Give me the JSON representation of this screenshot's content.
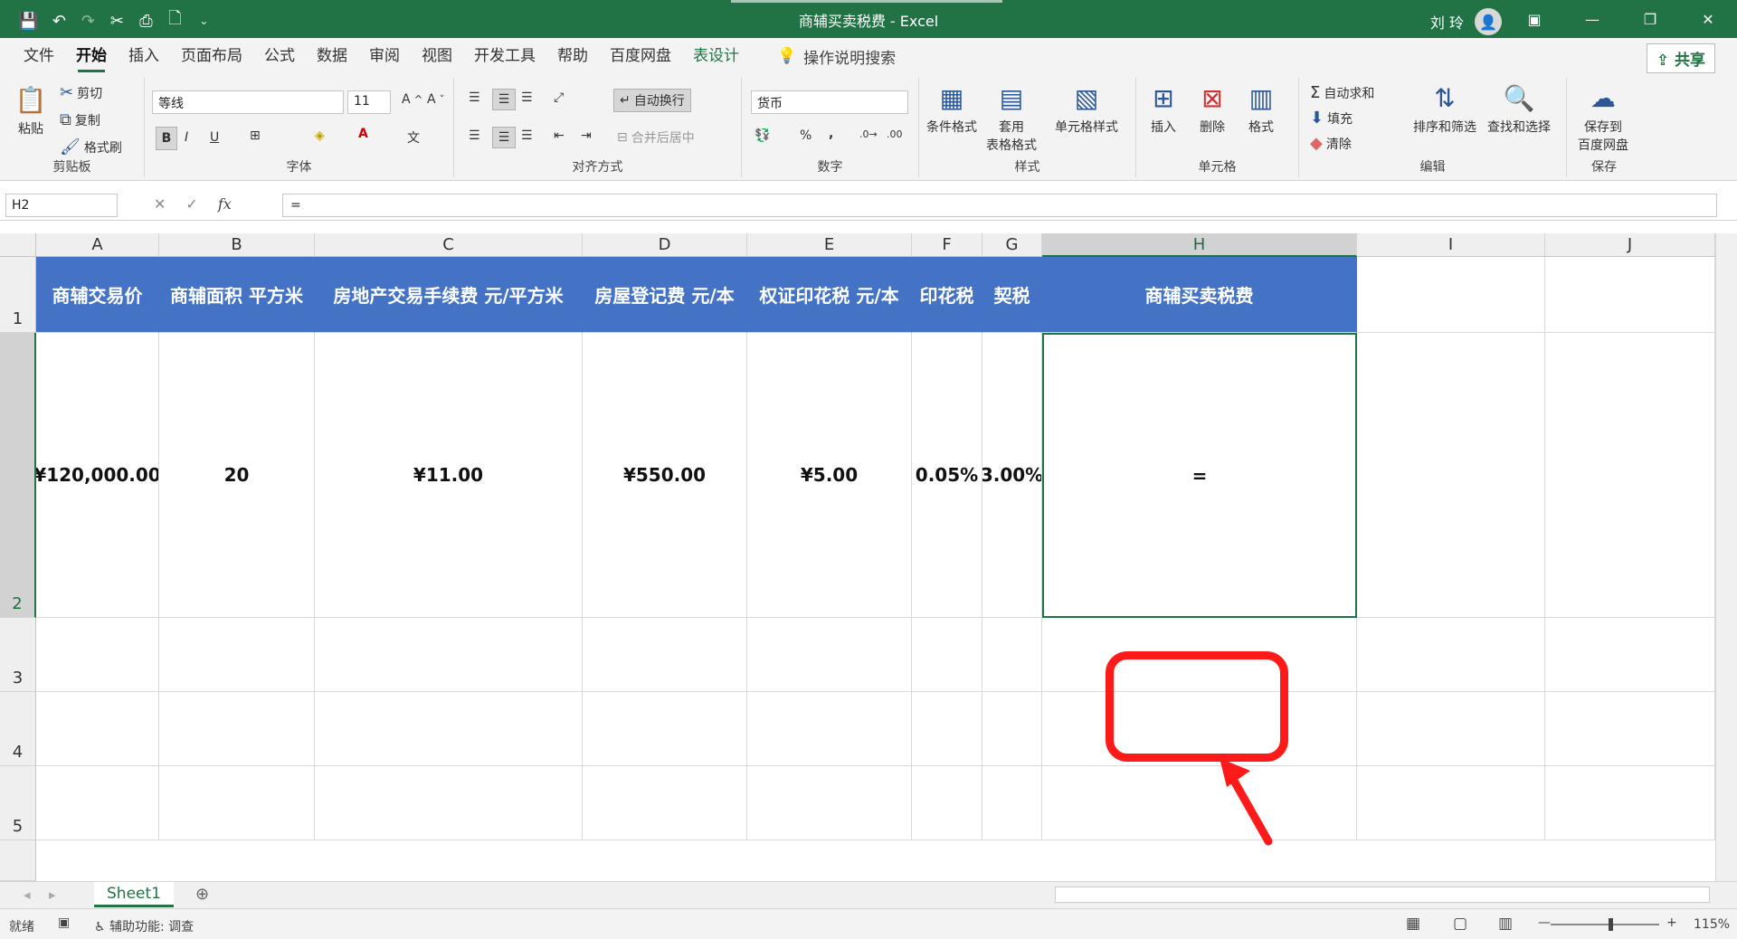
{
  "window": {
    "title": "商辅买卖税费  -  Excel",
    "user": "刘 玲",
    "share": "共享"
  },
  "tabs": [
    "文件",
    "开始",
    "插入",
    "页面布局",
    "公式",
    "数据",
    "审阅",
    "视图",
    "开发工具",
    "帮助",
    "百度网盘",
    "表设计"
  ],
  "tellme": "操作说明搜索",
  "ribbon": {
    "clipboard": {
      "paste": "粘贴",
      "cut": "剪切",
      "copy": "复制",
      "format_painter": "格式刷",
      "label": "剪贴板"
    },
    "font": {
      "name": "等线",
      "size": "11",
      "label": "字体"
    },
    "alignment": {
      "wrap": "自动换行",
      "merge": "合并后居中",
      "label": "对齐方式"
    },
    "number": {
      "format": "货币",
      "label": "数字"
    },
    "styles": {
      "cond": "条件格式",
      "table": "套用\n表格格式",
      "cell": "单元格样式",
      "label": "样式"
    },
    "cells": {
      "insert": "插入",
      "delete": "删除",
      "format": "格式",
      "label": "单元格"
    },
    "editing": {
      "autosum": "自动求和",
      "fill": "填充",
      "clear": "清除",
      "sort": "排序和筛选",
      "find": "查找和选择",
      "label": "编辑"
    },
    "save": {
      "baidu": "保存到\n百度网盘",
      "label": "保存"
    }
  },
  "formula_bar": {
    "namebox": "H2",
    "formula": "="
  },
  "columns": [
    "A",
    "B",
    "C",
    "D",
    "E",
    "F",
    "G",
    "H",
    "I",
    "J"
  ],
  "rows": [
    "1",
    "2",
    "3",
    "4",
    "5"
  ],
  "headers": [
    "商辅交易价",
    "商辅面积 平方米",
    "房地产交易手续费 元/平方米",
    "房屋登记费 元/本",
    "权证印花税 元/本",
    "印花税",
    "契税",
    "商辅买卖税费"
  ],
  "values": [
    "¥120,000.00",
    "20",
    "¥11.00",
    "¥550.00",
    "¥5.00",
    "0.05%",
    "3.00%",
    "="
  ],
  "sheet": {
    "name": "Sheet1"
  },
  "status": {
    "ready": "就绪",
    "accessibility": "辅助功能: 调查",
    "zoom": "115%"
  }
}
